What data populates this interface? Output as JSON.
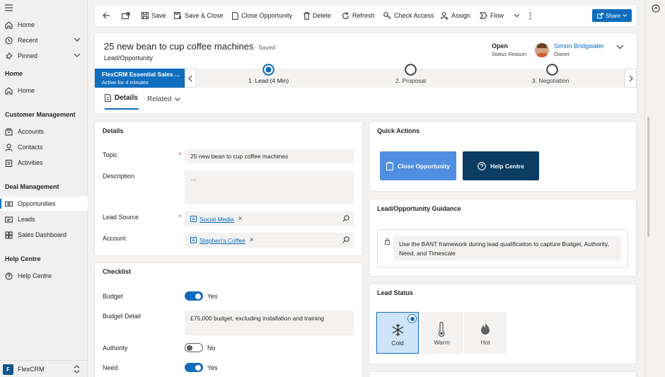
{
  "app": {
    "name": "FlexCRM",
    "initial": "F"
  },
  "sitemap": {
    "top_items": [
      {
        "label": "Home"
      },
      {
        "label": "Recent"
      },
      {
        "label": "Pinned"
      }
    ],
    "groups": [
      {
        "title": "Home",
        "items": [
          {
            "label": "Home"
          }
        ]
      },
      {
        "title": "Customer Management",
        "items": [
          {
            "label": "Accounts"
          },
          {
            "label": "Contacts"
          },
          {
            "label": "Activities"
          }
        ]
      },
      {
        "title": "Deal Management",
        "items": [
          {
            "label": "Opportunities"
          },
          {
            "label": "Leads"
          },
          {
            "label": "Sales Dashboard"
          }
        ]
      },
      {
        "title": "Help Centre",
        "items": [
          {
            "label": "Help Centre"
          }
        ]
      }
    ]
  },
  "commandbar": {
    "save": "Save",
    "save_close": "Save & Close",
    "close_opportunity": "Close Opportunity",
    "delete": "Delete",
    "refresh": "Refresh",
    "check_access": "Check Access",
    "assign": "Assign",
    "flow": "Flow",
    "share": "Share"
  },
  "record": {
    "title": "25 new bean to cup coffee machines",
    "save_state": "- Saved",
    "entity": "Lead/Opportunity",
    "status_value": "Open",
    "status_label": "Status Reason",
    "owner_name": "Simon Bridgwater",
    "owner_label": "Owner"
  },
  "bpf": {
    "name": "FlexCRM Essential Sales ...",
    "active_for": "Active for 4 minutes",
    "stages": [
      {
        "label": "1. Lead  (4 Min)",
        "active": true
      },
      {
        "label": "2. Proposal",
        "active": false
      },
      {
        "label": "3. Negotiation",
        "active": false
      }
    ]
  },
  "tabs": {
    "details": "Details",
    "related": "Related"
  },
  "details_section": {
    "title": "Details",
    "topic_label": "Topic",
    "topic_value": "25 new bean to cup coffee machines",
    "description_label": "Description",
    "description_value": "---",
    "lead_source_label": "Lead Source",
    "lead_source_value": "Social Media",
    "account_label": "Account",
    "account_value": "Stephen's Coffee",
    "required_mark": "*"
  },
  "checklist": {
    "title": "Checklist",
    "budget_label": "Budget",
    "budget_value": "Yes",
    "budget_detail_label": "Budget Detail",
    "budget_detail_value": "£75,000 budget, excluding installation and training",
    "authority_label": "Authority",
    "authority_value": "No",
    "need_label": "Need",
    "need_value": "Yes"
  },
  "quick_actions": {
    "title": "Quick Actions",
    "close_opportunity": "Close Opportunity",
    "help_centre": "Help Centre",
    "close_color": "#4f8ee0",
    "help_color": "#0b3c61"
  },
  "guidance": {
    "title": "Lead/Opportunity Guidance",
    "text": "Use the BANT framework during lead qualification to capture Budget, Authority, Need, and Timescale"
  },
  "lead_status": {
    "title": "Lead Status",
    "options": [
      {
        "label": "Cold",
        "selected": true,
        "icon": "snowflake-icon"
      },
      {
        "label": "Warm",
        "selected": false,
        "icon": "thermometer-icon"
      },
      {
        "label": "Hot",
        "selected": false,
        "icon": "flame-icon"
      }
    ]
  },
  "colors": {
    "accent": "#0f6cbd",
    "bpf_active": "#106ebe"
  }
}
